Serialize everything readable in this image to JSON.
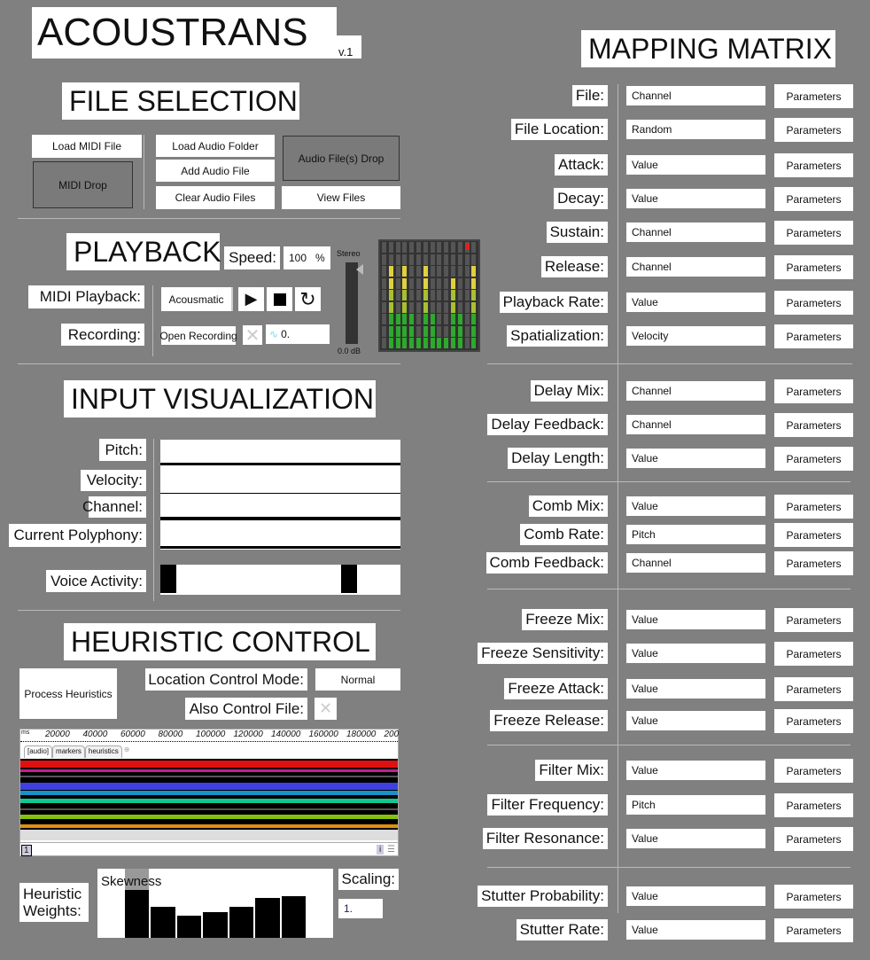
{
  "title": "ACOUSTRANS",
  "version": "v.1",
  "file_selection": {
    "heading": "FILE SELECTION",
    "load_midi": "Load MIDI File",
    "midi_drop": "MIDI Drop",
    "load_audio_folder": "Load Audio Folder",
    "add_audio_file": "Add Audio File",
    "clear_audio_files": "Clear Audio Files",
    "audio_drop": "Audio File(s) Drop",
    "view_files": "View Files"
  },
  "playback": {
    "heading": "PLAYBACK",
    "speed_label": "Speed:",
    "speed_value": "100",
    "speed_unit": "%",
    "midi_playback_label": "MIDI Playback:",
    "mode": "Acousmatic",
    "recording_label": "Recording:",
    "open_recording": "Open Recording",
    "record_value": "0.",
    "meter_label_top": "Stereo",
    "meter_label_bottom": "0.0 dB",
    "gain_level": 1.0,
    "meter_levels": [
      0.05,
      0.78,
      0.35,
      0.78,
      0.3,
      0.08,
      0.78,
      0.35,
      0.1,
      0.1,
      0.66,
      0.35,
      0.05,
      0.78
    ],
    "meter_colors": {
      "low": "#2ea82e",
      "mid": "#a8c030",
      "high": "#e0d040",
      "peak": "#f08030",
      "clip": "#e02020"
    }
  },
  "input_visualization": {
    "heading": "INPUT VISUALIZATION",
    "labels": [
      "Pitch:",
      "Velocity:",
      "Channel:",
      "Current Polyphony:",
      "Voice Activity:"
    ]
  },
  "heuristic_control": {
    "heading": "HEURISTIC CONTROL",
    "process": "Process Heuristics",
    "location_mode_label": "Location Control Mode:",
    "location_mode_value": "Normal",
    "also_control_file_label": "Also Control File:",
    "timeline": {
      "unit": "ms",
      "ticks": [
        "20000",
        "40000",
        "60000",
        "80000",
        "100000",
        "120000",
        "140000",
        "160000",
        "180000",
        "200"
      ],
      "tabs": [
        "[audio]",
        "markers",
        "heuristics"
      ],
      "page": "1",
      "info": "i"
    },
    "weights_label_1": "Heuristic",
    "weights_label_2": "Weights:",
    "weights_hover": "Skewness",
    "weights": [
      0,
      1.0,
      0.45,
      0.32,
      0.37,
      0.45,
      0.58,
      0.6,
      0
    ],
    "scaling_label": "Scaling:",
    "scaling_value": "1."
  },
  "mapping": {
    "heading": "MAPPING MATRIX",
    "params_label": "Parameters",
    "rows": [
      {
        "label": "File:",
        "value": "Channel"
      },
      {
        "label": "File Location:",
        "value": "Random"
      },
      {
        "label": "Attack:",
        "value": "Value"
      },
      {
        "label": "Decay:",
        "value": "Value"
      },
      {
        "label": "Sustain:",
        "value": "Channel"
      },
      {
        "label": "Release:",
        "value": "Channel"
      },
      {
        "label": "Playback Rate:",
        "value": "Value"
      },
      {
        "label": "Spatialization:",
        "value": "Velocity"
      },
      {
        "label": "Delay Mix:",
        "value": "Channel"
      },
      {
        "label": "Delay Feedback:",
        "value": "Channel"
      },
      {
        "label": "Delay Length:",
        "value": "Value"
      },
      {
        "label": "Comb Mix:",
        "value": "Value"
      },
      {
        "label": "Comb Rate:",
        "value": "Pitch"
      },
      {
        "label": "Comb Feedback:",
        "value": "Channel"
      },
      {
        "label": "Freeze Mix:",
        "value": "Value"
      },
      {
        "label": "Freeze Sensitivity:",
        "value": "Value"
      },
      {
        "label": "Freeze Attack:",
        "value": "Value"
      },
      {
        "label": "Freeze Release:",
        "value": "Value"
      },
      {
        "label": "Filter Mix:",
        "value": "Value"
      },
      {
        "label": "Filter Frequency:",
        "value": "Pitch"
      },
      {
        "label": "Filter Resonance:",
        "value": "Value"
      },
      {
        "label": "Stutter Probability:",
        "value": "Value"
      },
      {
        "label": "Stutter Rate:",
        "value": "Value"
      }
    ]
  }
}
